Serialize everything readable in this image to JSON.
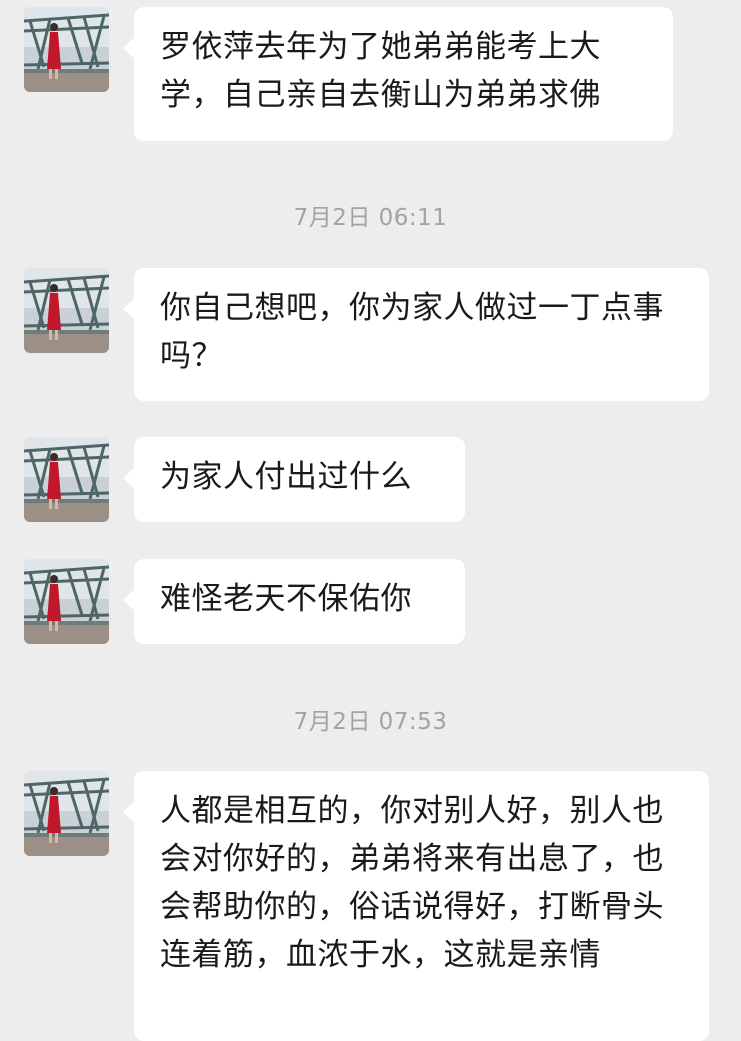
{
  "messages": [
    {
      "text": "罗依萍去年为了她弟弟能考上大学，自己亲自去衡山为弟弟求佛"
    },
    {
      "text": "你自己想吧，你为家人做过一丁点事吗？"
    },
    {
      "text": "为家人付出过什么"
    },
    {
      "text": "难怪老天不保佑你"
    },
    {
      "text": "人都是相互的，你对别人好，别人也会对你好的，弟弟将来有出息了，也会帮助你的，俗话说得好，打断骨头连着筋，血浓于水，这就是亲情"
    }
  ],
  "timestamps": [
    {
      "text": "7月2日 06:11"
    },
    {
      "text": "7月2日 07:53"
    }
  ],
  "colors": {
    "background": "#ededed",
    "bubble": "#ffffff",
    "timestamp": "#a3a3a3",
    "text": "#1a1a1a"
  }
}
